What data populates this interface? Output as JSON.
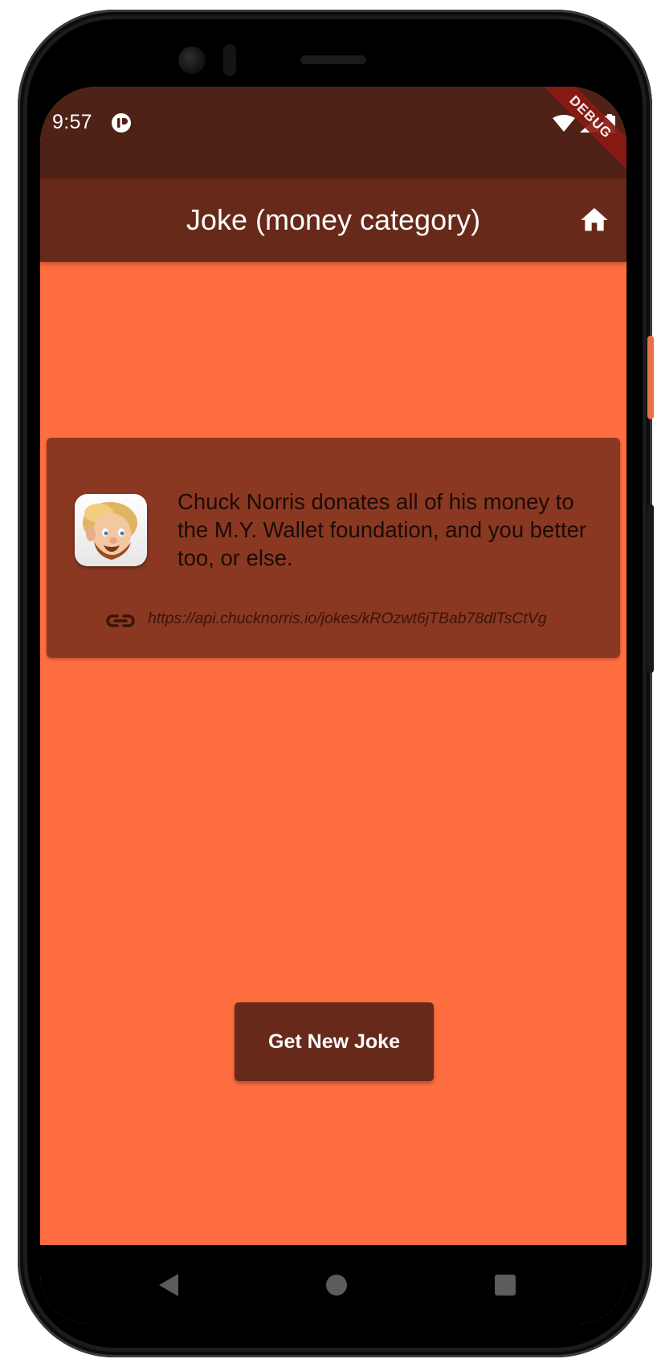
{
  "status_bar": {
    "time": "9:57",
    "debug_banner": "DEBUG"
  },
  "app_bar": {
    "title": "Joke (money category)",
    "home_icon": "home-icon"
  },
  "joke": {
    "text": "Chuck Norris donates all of his money to the M.Y. Wallet foundation, and you better too, or else.",
    "url": "https://api.chucknorris.io/jokes/kROzwt6jTBab78dlTsCtVg",
    "avatar_icon": "chuck-norris-avatar",
    "link_icon": "link-icon"
  },
  "actions": {
    "new_joke_label": "Get New Joke"
  },
  "nav": {
    "back_icon": "back-icon",
    "home_icon": "home-circle-icon",
    "recents_icon": "recents-icon"
  },
  "colors": {
    "background": "#ff6e40",
    "status_bar": "#4e2217",
    "app_bar": "#67291a",
    "card": "#8a3822",
    "button": "#67291a",
    "debug_banner": "#8b1a12"
  }
}
